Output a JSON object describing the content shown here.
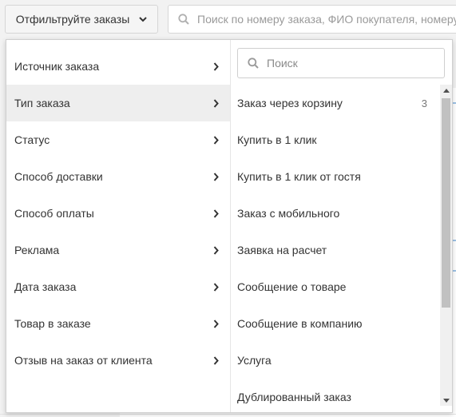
{
  "toolbar": {
    "filter_button_label": "Отфильтруйте заказы",
    "search_placeholder": "Поиск по номеру заказа, ФИО покупателя, номеру телефона"
  },
  "filter_panel": {
    "categories": [
      {
        "label": "Источник заказа",
        "active": false
      },
      {
        "label": "Тип заказа",
        "active": true
      },
      {
        "label": "Статус",
        "active": false
      },
      {
        "label": "Способ доставки",
        "active": false
      },
      {
        "label": "Способ оплаты",
        "active": false
      },
      {
        "label": "Реклама",
        "active": false
      },
      {
        "label": "Дата заказа",
        "active": false
      },
      {
        "label": "Товар в заказе",
        "active": false
      },
      {
        "label": "Отзыв на заказ от клиента",
        "active": false
      }
    ],
    "options_search_placeholder": "Поиск",
    "options": [
      {
        "label": "Заказ через корзину",
        "count": "3"
      },
      {
        "label": "Купить в 1 клик",
        "count": ""
      },
      {
        "label": "Купить в 1 клик от гостя",
        "count": ""
      },
      {
        "label": "Заказ с мобильного",
        "count": ""
      },
      {
        "label": "Заявка на расчет",
        "count": ""
      },
      {
        "label": "Сообщение о товаре",
        "count": ""
      },
      {
        "label": "Сообщение в компанию",
        "count": ""
      },
      {
        "label": "Услуга",
        "count": ""
      },
      {
        "label": "Дублированный заказ",
        "count": ""
      }
    ]
  },
  "icons": {
    "filter_chevron": "chevron-down-icon",
    "search": "search-icon",
    "category_arrow": "chevron-right-icon"
  },
  "colors": {
    "background": "#f2f2f2",
    "active_row": "#eeeeee",
    "border": "#cfcfcf",
    "text": "#333333"
  }
}
